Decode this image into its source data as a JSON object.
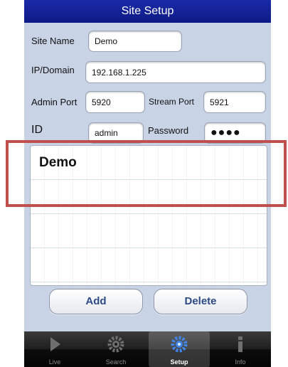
{
  "title": "Site Setup",
  "form": {
    "site_name_label": "Site Name",
    "site_name_value": "Demo",
    "ip_label": "IP/Domain",
    "ip_value": "192.168.1.225",
    "admin_port_label": "Admin Port",
    "admin_port_value": "5920",
    "stream_port_label": "Stream Port",
    "stream_port_value": "5921",
    "id_label": "ID",
    "id_value": "admin",
    "password_label": "Password",
    "password_value": "●●●●"
  },
  "sites": [
    "Demo",
    "",
    "",
    ""
  ],
  "buttons": {
    "add": "Add",
    "delete": "Delete"
  },
  "tabs": [
    {
      "label": "Live",
      "icon": "play-icon"
    },
    {
      "label": "Search",
      "icon": "search-gear-icon"
    },
    {
      "label": "Setup",
      "icon": "gear-icon"
    },
    {
      "label": "Info",
      "icon": "info-icon"
    }
  ],
  "active_tab": "Setup",
  "colors": {
    "titlebar": "#0d1a86",
    "highlight": "#c0504d",
    "button_text": "#2c4a86"
  }
}
